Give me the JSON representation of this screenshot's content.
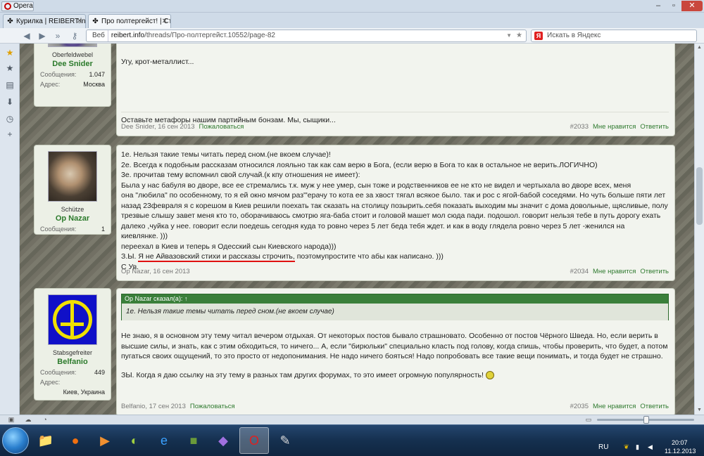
{
  "browser": {
    "menu_label": "Opera",
    "tabs": [
      {
        "title": "Курилка | REIBERT.info",
        "icon": "clover-icon"
      },
      {
        "title": "Про полтергейст! | Ст...",
        "icon": "clover-icon"
      }
    ],
    "url_badge": "Веб",
    "url_host": "reibert.info",
    "url_path": "/threads/Про-полтергейст.10552/page-82",
    "search_placeholder": "Искать в Яндекс",
    "search_provider": "Я"
  },
  "posts": [
    {
      "rank": "Oberfeldwebel",
      "username": "Dee Snider",
      "stats": [
        {
          "label": "Сообщения:",
          "value": "1.047"
        },
        {
          "label": "Адрес:",
          "value": "Москва"
        }
      ],
      "lines": [
        "Угу, крот-металлист..."
      ],
      "signature": "Оставьте метафоры нашим партийным бонзам. Мы, сыщики...",
      "footer": {
        "author_date": "Dee Snider, 16 сен 2013",
        "report": "Пожаловаться",
        "number": "#2033",
        "dislike": "Мне нравится",
        "reply": "Ответить"
      }
    },
    {
      "rank": "Schütze",
      "username": "Op Nazar",
      "stats": [
        {
          "label": "Сообщения:",
          "value": "1"
        }
      ],
      "lines": [
        "1е. Нельзя такие темы читать перед сном.(не вкоем случае)!",
        "2е. Всегда к подобным рассказам относился лояльно так как сам верю в Бога, (если верю в Бога то как в остальное не верить.ЛОГИЧНО)",
        "3е. прочитав тему вспомнил свой случай.(к кпу отношения не имеет):",
        "Была у нас бабуля во дворе, все ее стремались т.к. муж у нее умер, сын тоже и родственников ее не кто не видел и чертыхала во дворе всех, меня",
        "она \"любила\" по особенному, то я ей окно мячом раз'\"ерачу то кота ее за хвост тягал всякое было. так и рос с ягой-бабой соседями. Но чуть больше пяти лет",
        "назад 23февраля я с корешом в Киев решили поехать так сказать на столицу позырить.себя показать выходим мы значит с дома довольные, щясливые, полу",
        "трезвые слышу завет меня кто то, оборачиваюсь смотрю яга-баба стоит и головой машет мол сюда пади. подошол. говорит нельзя тебе в путь дорогу ехать",
        "далеко ,чуйка у нее. говорит если поедешь сегодня куда то ровно через 5 лет беда тебя ждет. и как в воду глядела ровно через 5 лет -женился на",
        "киевлянке. )))",
        "переехал в Киев и теперь я Одесский сын Киевского народа)))"
      ],
      "ps_prefix": "З.Ы. ",
      "ps_underlined": "Я не Айвазовский стихи и рассказы строчить,",
      "ps_rest": " поэтомупростите что абы как написано. )))",
      "closing": "С Ув.",
      "footer": {
        "author_date": "Op Nazar, 16 сен 2013",
        "report": "",
        "number": "#2034",
        "dislike": "Мне нравится",
        "reply": "Ответить"
      }
    },
    {
      "rank": "Stabsgefreiter",
      "username": "Belfanio",
      "stats": [
        {
          "label": "Сообщения:",
          "value": "449"
        },
        {
          "label": "Адрес:",
          "value": ""
        }
      ],
      "location": "Киев, Украина",
      "quote_header": "Op Nazar сказал(а): ↑",
      "quote_text": "1е. Нельзя такие темы читать перед сном.(не вкоем случае)",
      "lines": [
        "Не знаю, я в основном эту тему читал вечером отдыхая. От некоторых постов бывало страшновато. Особенно от постов Чёрного Шведа. Но, если верить в",
        "высшие силы, и знать, как с этим обходиться, то ничего... А, если \"бирюльки\" специально класть под голову, когда спишь, чтобы проверить, что будет, а потом",
        "пугаться своих ощущений, то это просто от недопонимания. Не надо ничего бояться! Надо попробовать все такие вещи понимать, и тогда будет не страшно."
      ],
      "ps": "ЗЫ. Когда я даю ссылку на эту тему в разных там других форумах, то это имеет огромную популярность!",
      "footer": {
        "author_date": "Belfanio, 17 сен 2013",
        "report": "Пожаловаться",
        "number": "#2035",
        "dislike": "Мне нравится",
        "reply": "Ответить"
      }
    }
  ],
  "taskbar": {
    "lang": "RU",
    "time": "20:07",
    "date": "11.12.2013"
  }
}
